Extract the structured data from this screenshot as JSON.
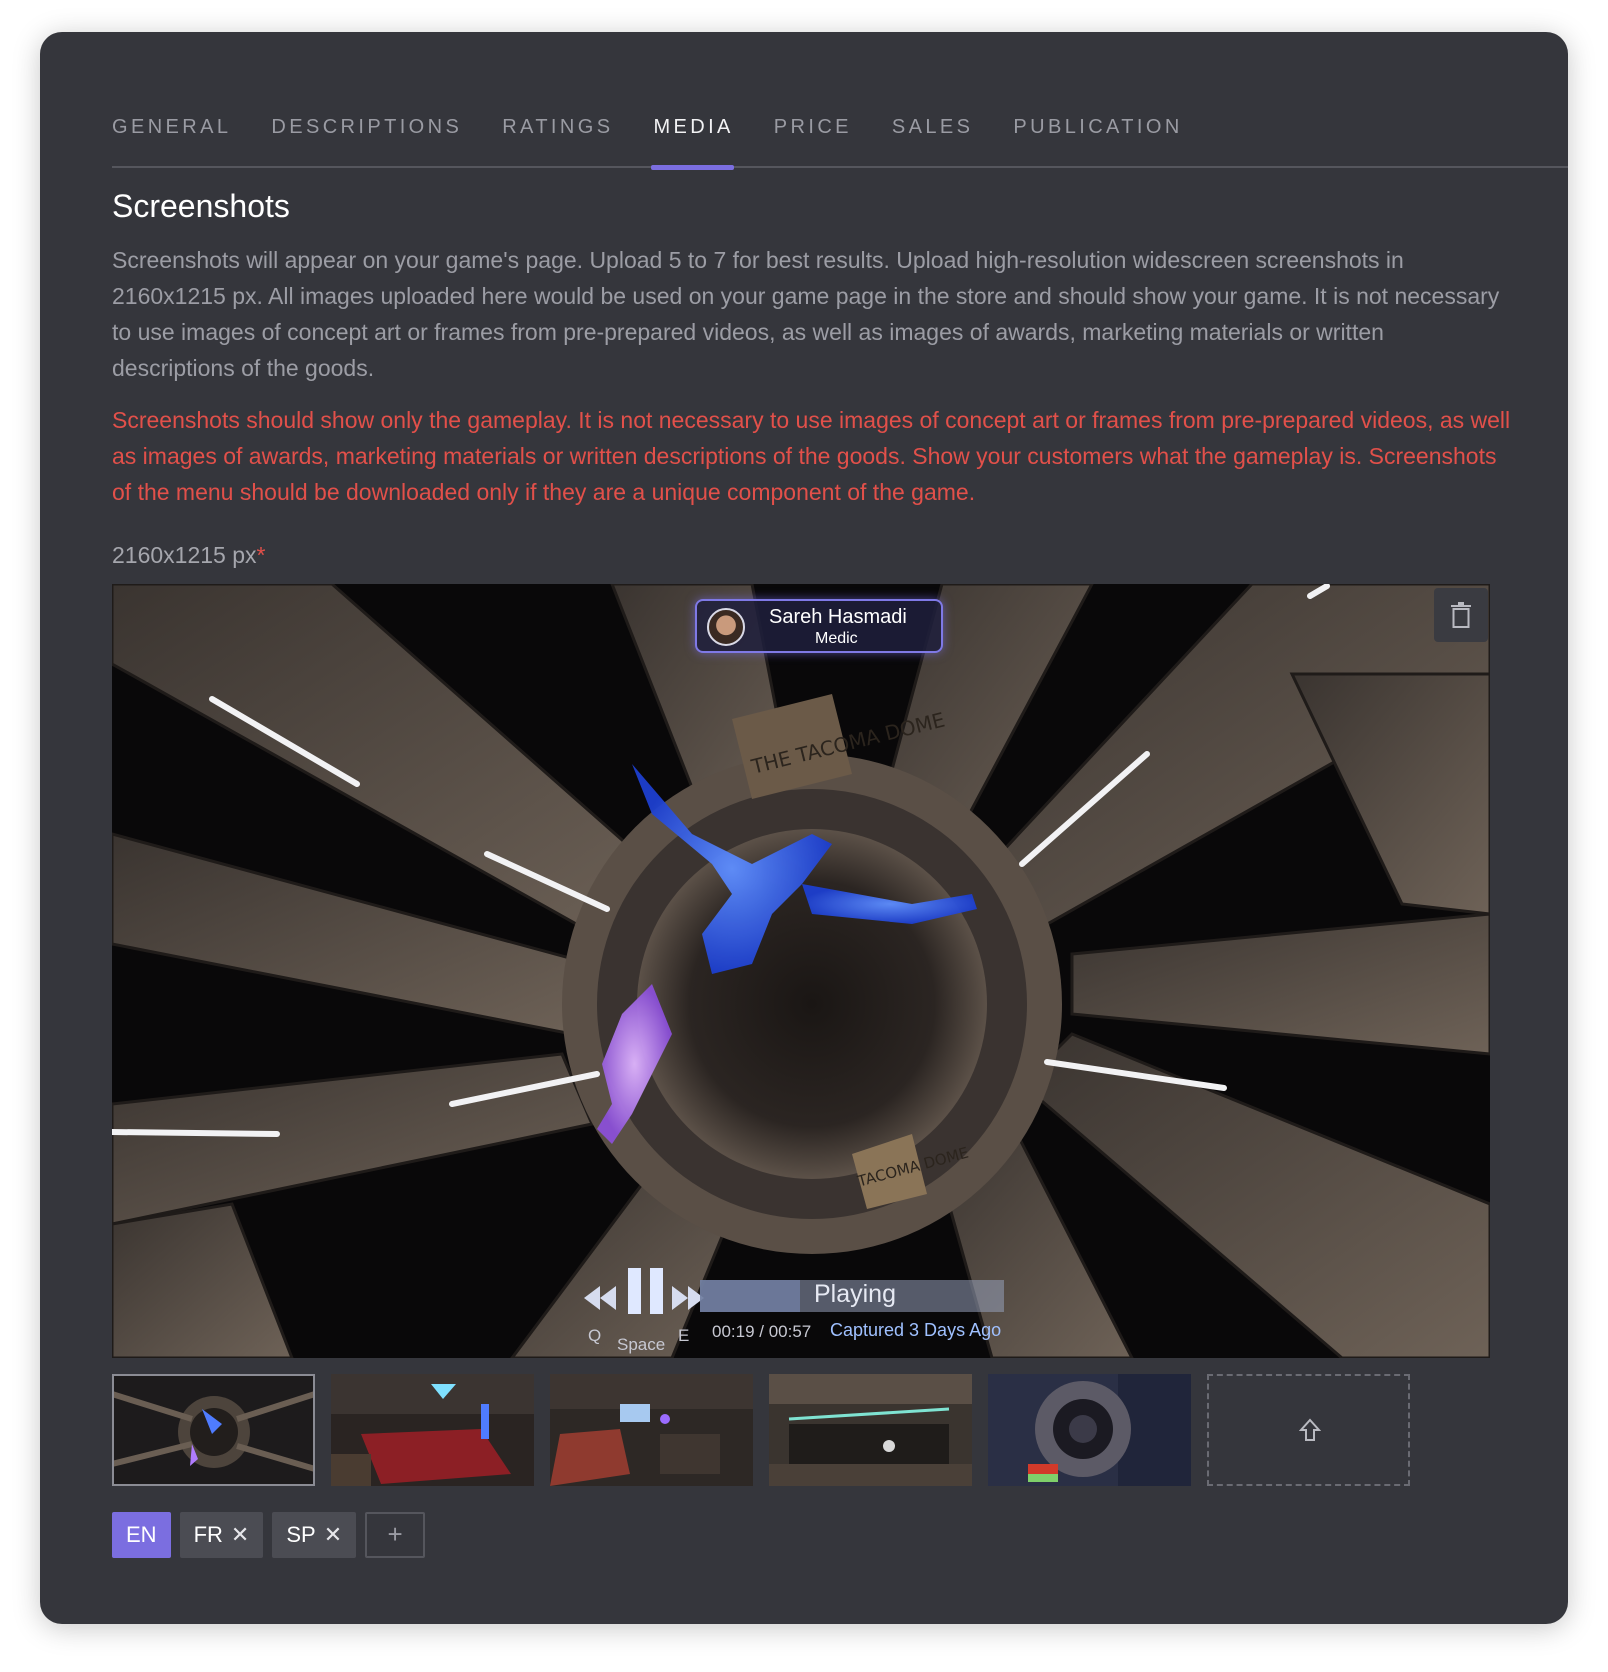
{
  "tabs": [
    {
      "label": "GENERAL"
    },
    {
      "label": "DESCRIPTIONS"
    },
    {
      "label": "RATINGS"
    },
    {
      "label": "MEDIA"
    },
    {
      "label": "PRICE"
    },
    {
      "label": "SALES"
    },
    {
      "label": "PUBLICATION"
    }
  ],
  "active_tab": "MEDIA",
  "section": {
    "title": "Screenshots",
    "description": "Screenshots will appear on your game's page. Upload 5 to 7 for best results. Upload high-resolution widescreen screenshots in 2160x1215 px. All images uploaded here would be used on your game page in the store and should show your game. It is not necessary to use images of concept art or frames from pre-prepared videos, as well as images of awards, marketing materials or written descriptions of the goods.",
    "warning": "Screenshots should show only the gameplay. It is not necessary to use images of concept art or frames from pre-prepared videos, as well as images of awards, marketing materials or written descriptions of the goods. Show your customers what the gameplay is. Screenshots of the menu should be downloaded only if they are a unique component of the game.",
    "size_label": "2160x1215 px",
    "required_mark": "*"
  },
  "preview": {
    "character_name": "Sareh Hasmadi",
    "character_role": "Medic",
    "sign_text_1": "THE TACOMA DOME",
    "sign_text_2": "TACOMA DOME",
    "player": {
      "status": "Playing",
      "time": "00:19 / 00:57",
      "captured": "Captured 3 Days Ago",
      "key_rewind": "Q",
      "key_pause": "Space",
      "key_forward": "E",
      "progress": 0.33
    }
  },
  "thumbnails": [
    {
      "name": "observation-deck"
    },
    {
      "name": "billiards-lounge"
    },
    {
      "name": "living-quarters"
    },
    {
      "name": "corridor"
    },
    {
      "name": "airlock-hatch"
    }
  ],
  "languages": [
    {
      "code": "EN",
      "active": true,
      "removable": false
    },
    {
      "code": "FR",
      "active": false,
      "removable": true
    },
    {
      "code": "SP",
      "active": false,
      "removable": true
    }
  ],
  "remove_glyph": "✕",
  "add_language_glyph": "+",
  "colors": {
    "accent": "#7b6ee0",
    "panel": "#35363c",
    "warning": "#e2504a"
  }
}
